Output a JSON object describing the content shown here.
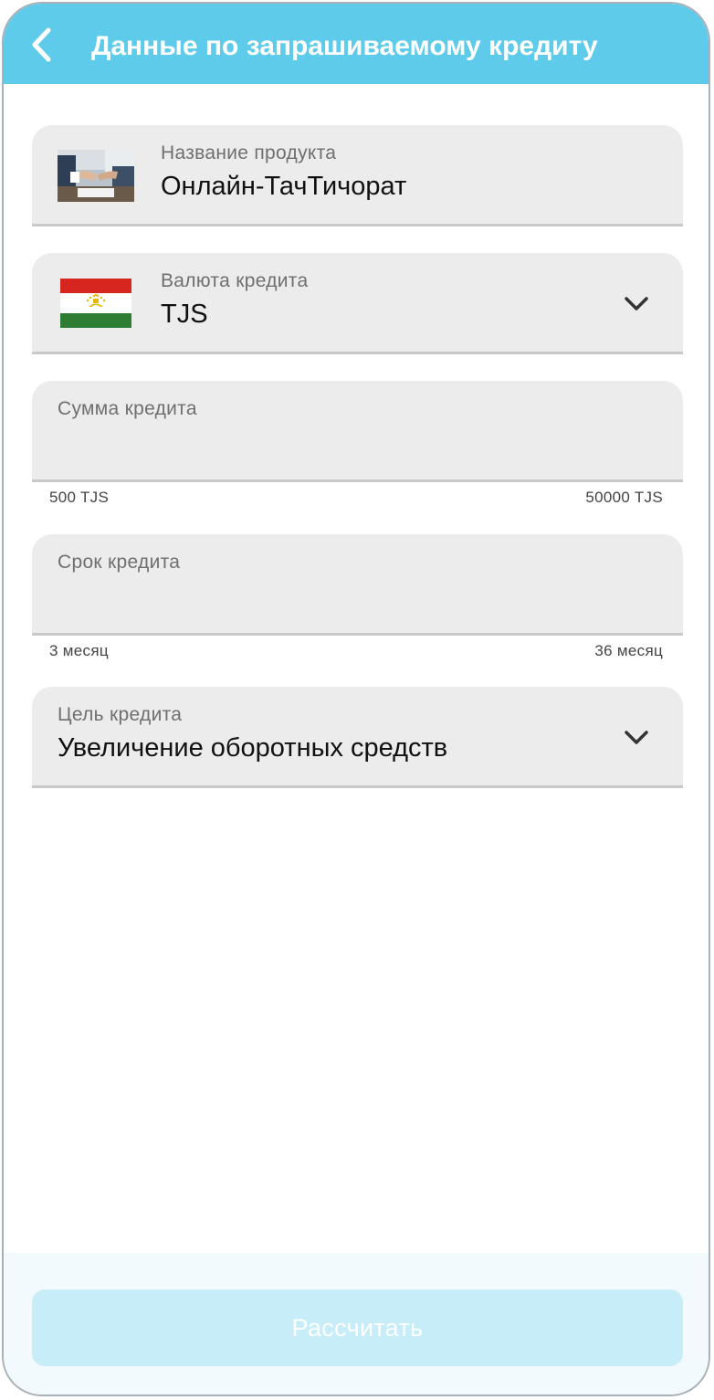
{
  "header": {
    "title": "Данные по запрашиваемому кредиту",
    "back_icon": "chevron-left-icon",
    "bg_color": "#5fcbea"
  },
  "product": {
    "label": "Название продукта",
    "value": "Онлайн-ТачТичорат"
  },
  "currency": {
    "label": "Валюта кредита",
    "value": "TJS",
    "icon": "chevron-down-icon"
  },
  "amount": {
    "label": "Сумма кредита",
    "value": "",
    "min_label": "500 TJS",
    "max_label": "50000 TJS"
  },
  "term": {
    "label": "Срок кредита",
    "value": "",
    "min_label": "3 месяц",
    "max_label": "36 месяц"
  },
  "purpose": {
    "label": "Цель кредита",
    "value": "Увеличение оборотных средств",
    "icon": "chevron-down-icon"
  },
  "calculate_button": {
    "label": "Рассчитать",
    "state": "disabled",
    "bg_color": "#c7edf8"
  }
}
